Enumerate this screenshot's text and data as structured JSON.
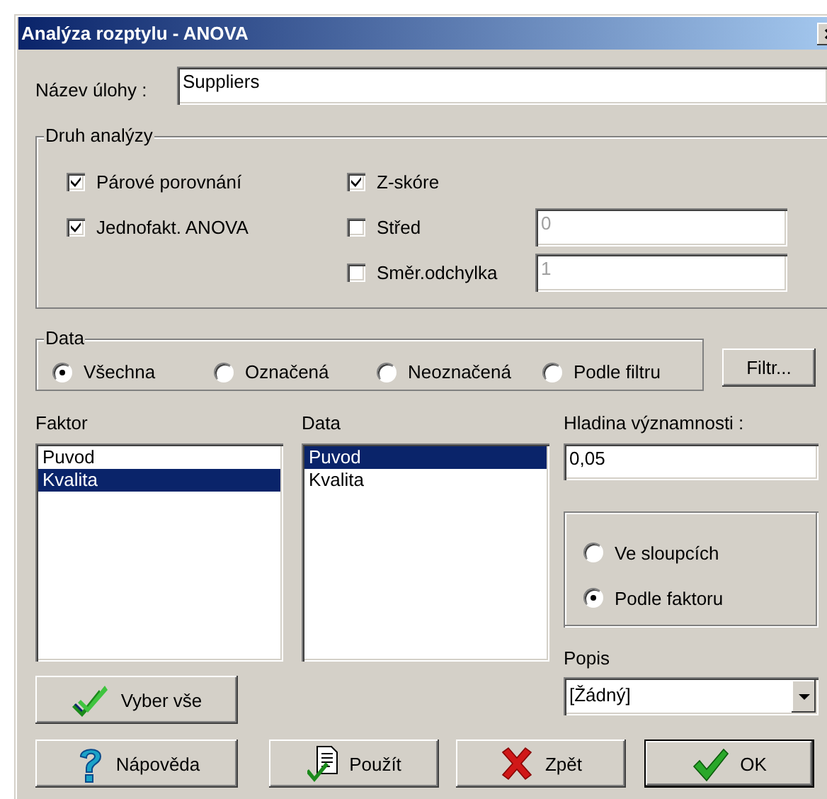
{
  "window": {
    "title": "Analýza rozptylu - ANOVA"
  },
  "task_name": {
    "label": "Název úlohy :",
    "value": "Suppliers"
  },
  "analysis_type": {
    "title": "Druh analýzy",
    "columns": [
      [
        {
          "kind": "checkbox",
          "label": "Párové porovnání",
          "checked": true
        },
        {
          "kind": "checkbox",
          "label": "Jednofakt. ANOVA",
          "checked": true
        }
      ],
      [
        {
          "kind": "checkbox",
          "label": "Z-skóre",
          "checked": true
        },
        {
          "kind": "checkbox_field",
          "label": "Střed",
          "checked": false,
          "value": "0",
          "disabled": true
        },
        {
          "kind": "checkbox_field",
          "label": "Směr.odchylka",
          "checked": false,
          "value": "1",
          "disabled": true
        }
      ]
    ]
  },
  "data": {
    "title": "Data",
    "options": [
      {
        "label": "Všechna",
        "selected": true
      },
      {
        "label": "Označená",
        "selected": false
      },
      {
        "label": "Neoznačená",
        "selected": false
      },
      {
        "label": "Podle filtru",
        "selected": false
      }
    ]
  },
  "filter_button": "Filtr...",
  "factor": {
    "label": "Faktor",
    "items": [
      {
        "label": "Puvod",
        "selected": false
      },
      {
        "label": "Kvalita",
        "selected": true
      }
    ]
  },
  "data_list": {
    "label": "Data",
    "items": [
      {
        "label": "Puvod",
        "selected": true
      },
      {
        "label": "Kvalita",
        "selected": false
      }
    ]
  },
  "significance": {
    "label": "Hladina významnosti :",
    "value": "0,05"
  },
  "layout": {
    "options": [
      {
        "label": "Ve sloupcích",
        "selected": false
      },
      {
        "label": "Podle faktoru",
        "selected": true
      }
    ]
  },
  "description": {
    "label": "Popis",
    "value": "[Žádný]"
  },
  "select_all": {
    "label": "Vyber vše",
    "kind": "select"
  },
  "buttons": [
    {
      "label": "Nápověda",
      "kind": "help",
      "default": false
    },
    {
      "label": "Použít",
      "kind": "apply",
      "default": false
    },
    {
      "label": "Zpět",
      "kind": "cancel",
      "default": false
    },
    {
      "label": "OK",
      "kind": "confirm",
      "default": true
    }
  ]
}
